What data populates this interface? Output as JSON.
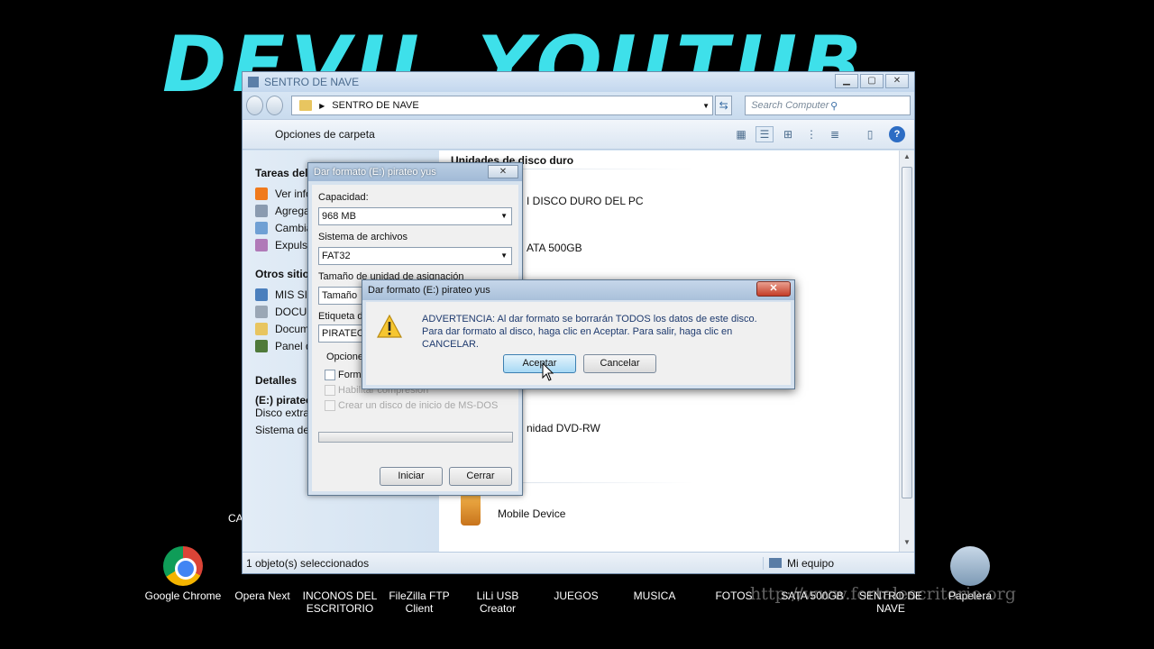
{
  "desktop": {
    "banner": "DEVIL YOUTUB",
    "side_label": "CA",
    "watermark": "http://www.fortalescritorio.org",
    "icons": [
      {
        "label": "Google Chrome",
        "icon": "chrome-icon"
      },
      {
        "label": "Opera Next",
        "icon": "opera-icon"
      },
      {
        "label": "INCONOS DEL\nESCRITORIO",
        "icon": "folder-icon"
      },
      {
        "label": "FileZilla FTP\nClient",
        "icon": "filezilla-icon"
      },
      {
        "label": "LiLi USB Creator",
        "icon": "lili-icon"
      },
      {
        "label": "JUEGOS",
        "icon": "folder-icon"
      },
      {
        "label": "MUSICA",
        "icon": "folder-icon"
      },
      {
        "label": "FOTOS",
        "icon": "folder-icon"
      },
      {
        "label": "SATA 500GB",
        "icon": "drive-icon"
      },
      {
        "label": "SENTRO DE\nNAVE",
        "icon": "computer-icon"
      },
      {
        "label": "Papelera",
        "icon": "recycle-bin-icon"
      }
    ]
  },
  "explorer": {
    "title": "SENTRO DE NAVE",
    "address": "SENTRO DE NAVE",
    "search_placeholder": "Search Computer",
    "toolbar": {
      "options": "Opciones de carpeta"
    },
    "sidebar": {
      "tasks_header": "Tareas del s",
      "tasks": [
        "Ver info",
        "Agrega",
        "Cambia",
        "Expulsa"
      ],
      "other_header": "Otros sitios",
      "other": [
        "MIS SIT",
        "DOCUM",
        "Docum",
        "Panel d"
      ],
      "details_header": "Detalles",
      "details_name": "(E:) pirateo",
      "details_type": "Disco extrai",
      "details_fs": "Sistema de"
    },
    "main": {
      "group_header": "Unidades de disco duro",
      "drives": [
        "I DISCO DURO DEL PC",
        "ATA 500GB",
        "nidad DVD-RW",
        "Mobile Device"
      ]
    },
    "status": {
      "left": "1 objeto(s) seleccionados",
      "right": "Mi equipo"
    }
  },
  "format_dialog": {
    "title": "Dar formato (E:) pirateo yus",
    "capacity_label": "Capacidad:",
    "capacity_value": "968 MB",
    "fs_label": "Sistema de archivos",
    "fs_value": "FAT32",
    "alloc_label": "Tamaño de unidad de asignación",
    "alloc_value": "Tamaño",
    "volume_label": "Etiqueta de",
    "volume_value": "PIRATEO",
    "options_label": "Opciones",
    "opt_quick": "Forma",
    "opt_compress": "Habilitar compresión",
    "opt_msdos": "Crear un disco de inicio de MS-DOS",
    "start": "Iniciar",
    "close": "Cerrar"
  },
  "warning_dialog": {
    "title": "Dar formato (E:) pirateo yus",
    "line1": "ADVERTENCIA: Al dar formato se borrarán TODOS los datos de este disco.",
    "line2": "Para dar formato al disco, haga clic en Aceptar. Para salir, haga clic en CANCELAR.",
    "ok": "Aceptar",
    "cancel": "Cancelar"
  }
}
